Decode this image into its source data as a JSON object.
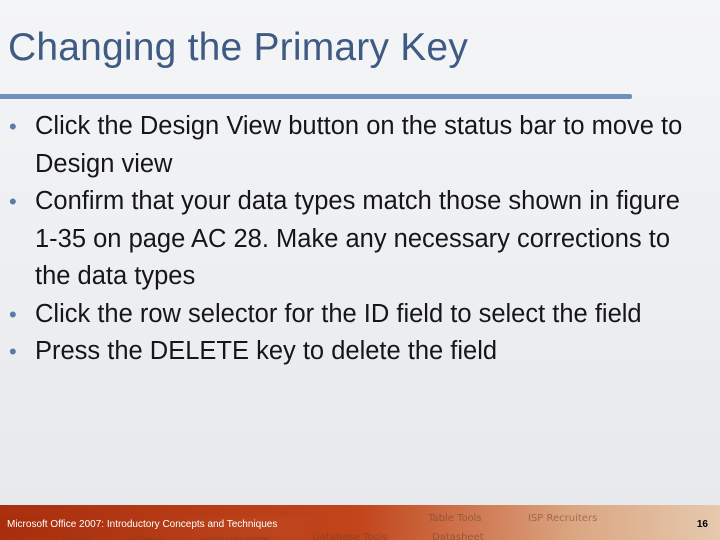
{
  "slide": {
    "title": "Changing the Primary Key",
    "bullets": [
      {
        "text": "Click the Design View button on the status bar to move to Design view"
      },
      {
        "text": "Confirm that your data types match those shown in figure 1-35 on page AC 28. Make any necessary corrections to the data types"
      },
      {
        "text": "Click the row selector for the ID field to select the field"
      },
      {
        "text": "Press the DELETE key to delete the field"
      }
    ],
    "bullet_glyph": "•"
  },
  "footer": {
    "text": "Microsoft Office 2007: Introductory Concepts and Techniques",
    "page_number": "16",
    "ribbon_labels": [
      "Table Tools",
      "ISP Recruiters",
      "Home",
      "Create",
      "External Data",
      "Database Tools",
      "Datasheet"
    ]
  },
  "colors": {
    "title": "#3f5b84",
    "rule": "#6f8fbd",
    "bullet": "#5a7aa8",
    "footer": "#b23a14"
  }
}
